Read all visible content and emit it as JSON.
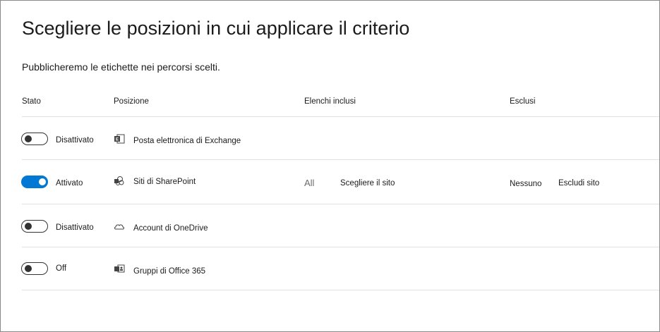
{
  "page": {
    "title": "Scegliere le posizioni in cui applicare il criterio",
    "subtitle": "Pubblicheremo le etichette nei percorsi scelti."
  },
  "table": {
    "headers": {
      "stato": "Stato",
      "posizione": "Posizione",
      "elenchi_inclusi": "Elenchi inclusi",
      "esclusi": "Esclusi"
    },
    "rows": [
      {
        "state": "off",
        "state_label": "Disattivato",
        "icon": "exchange-icon",
        "location": "Posta elettronica di Exchange"
      },
      {
        "state": "on",
        "state_label": "Attivato",
        "icon": "sharepoint-icon",
        "location": "Siti di SharePoint",
        "included_value": "All",
        "included_action": "Scegliere il sito",
        "excluded_value": "Nessuno",
        "excluded_action": "Escludi sito"
      },
      {
        "state": "off",
        "state_label": "Disattivato",
        "icon": "onedrive-icon",
        "location": "Account di OneDrive"
      },
      {
        "state": "off",
        "state_label": "Off",
        "icon": "office365-groups-icon",
        "location": "Gruppi di Office 365"
      }
    ]
  },
  "colors": {
    "accent": "#0078d4",
    "text": "#1b1b1b",
    "muted": "#6b6b6b",
    "divider": "#e1e1e1"
  }
}
